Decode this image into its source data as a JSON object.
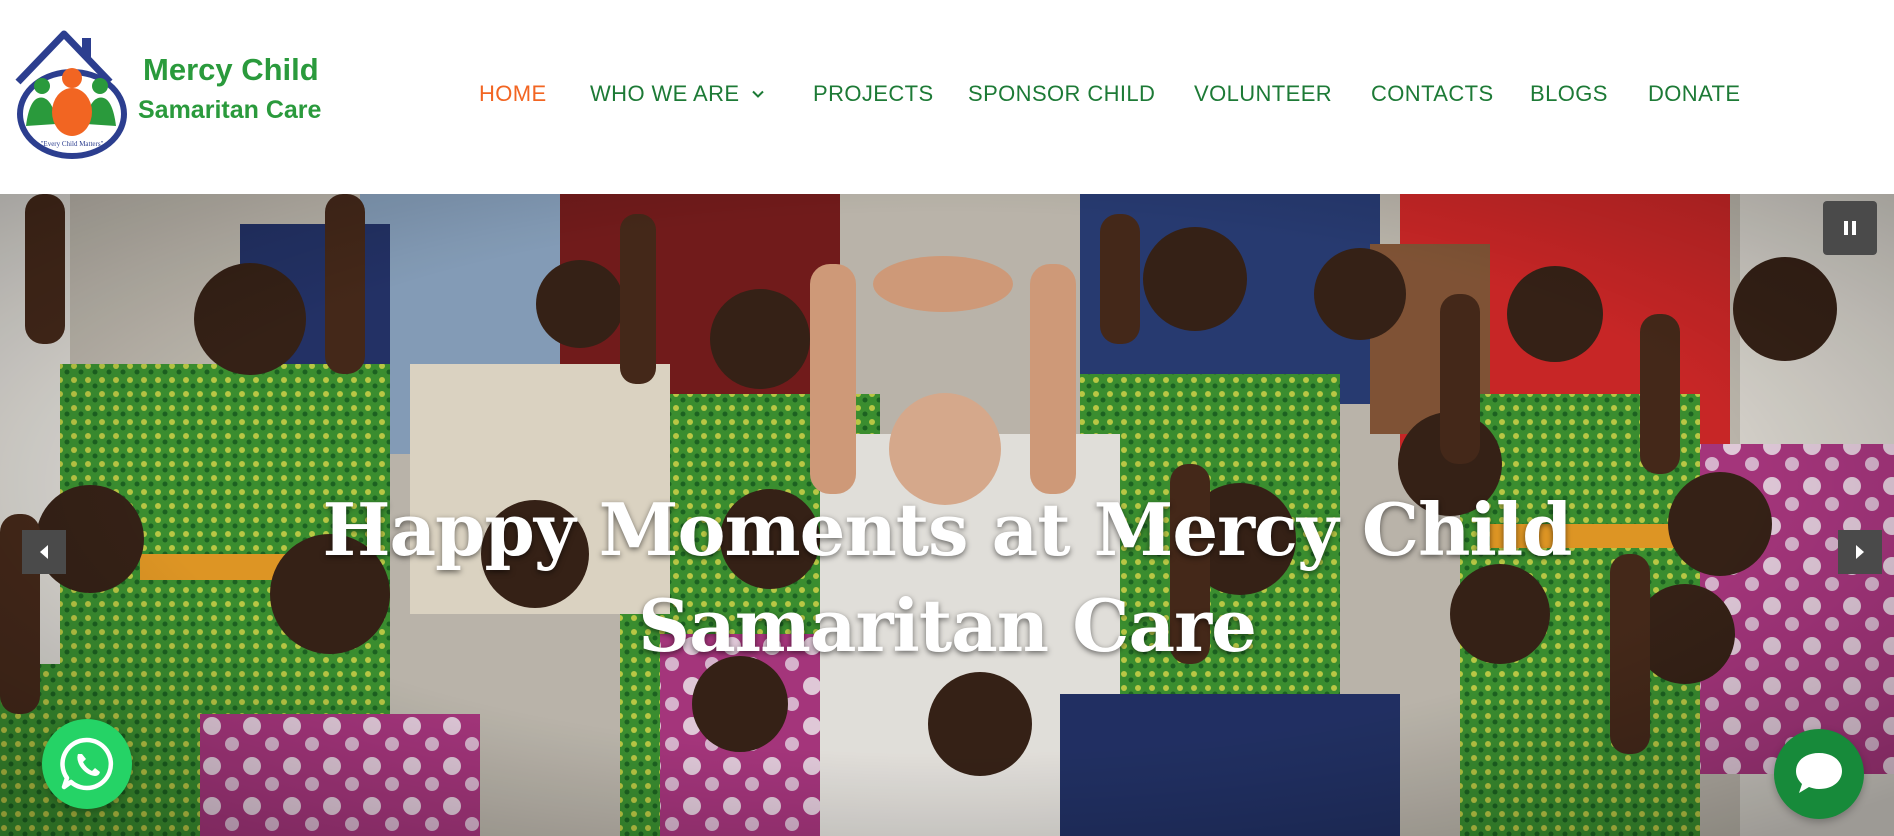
{
  "brand": {
    "name_line1": "Mercy Child",
    "name_line2": "Samaritan Care",
    "tagline": "\"Every Child Matters\"",
    "colors": {
      "green": "#1d7a36",
      "orange": "#f26522",
      "navy": "#2c3e8f"
    }
  },
  "nav": {
    "items": [
      {
        "label": "HOME",
        "active": true
      },
      {
        "label": "WHO WE ARE",
        "has_dropdown": true
      },
      {
        "label": "PROJECTS"
      },
      {
        "label": "SPONSOR CHILD"
      },
      {
        "label": "VOLUNTEER"
      },
      {
        "label": "CONTACTS"
      },
      {
        "label": "BLOGS"
      },
      {
        "label": "DONATE"
      }
    ],
    "dropdown_icon": "chevron-down-icon"
  },
  "hero": {
    "title_line1": "Happy Moments at Mercy Child",
    "title_line2": "Samaritan Care",
    "image_description_icon": "group-photo"
  },
  "slider": {
    "pause_icon": "pause-icon",
    "prev_icon": "arrow-left-icon",
    "next_icon": "arrow-right-icon"
  },
  "floating": {
    "whatsapp_icon": "whatsapp-icon",
    "chat_icon": "chat-bubble-icon"
  }
}
